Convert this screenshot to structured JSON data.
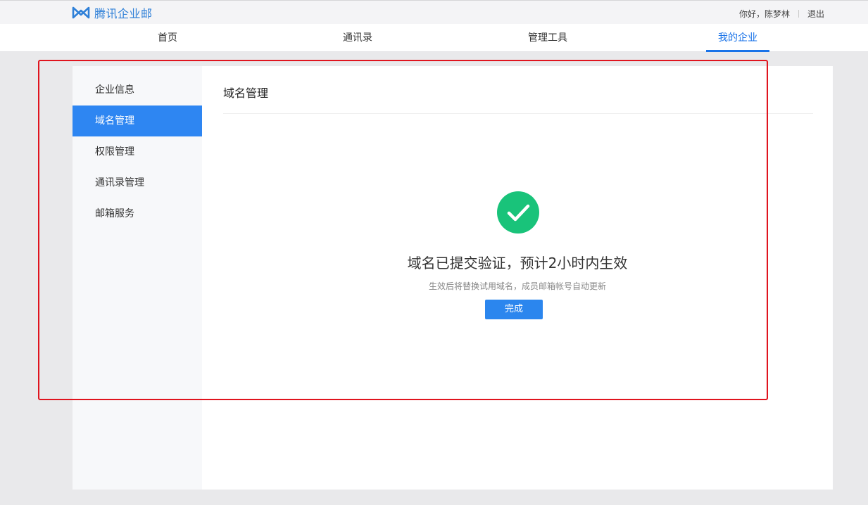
{
  "app": {
    "logo_text": "腾讯企业邮",
    "greeting": "你好，陈梦林",
    "logout": "退出",
    "brand_color": "#2f80d8"
  },
  "nav": {
    "items": [
      {
        "label": "首页"
      },
      {
        "label": "通讯录"
      },
      {
        "label": "管理工具"
      },
      {
        "label": "我的企业",
        "active": true
      }
    ],
    "accent": "#1a73e8"
  },
  "sidebar": {
    "items": [
      {
        "label": "企业信息"
      },
      {
        "label": "域名管理",
        "active": true
      },
      {
        "label": "权限管理"
      },
      {
        "label": "通讯录管理"
      },
      {
        "label": "邮箱服务"
      }
    ]
  },
  "content": {
    "title": "域名管理",
    "status_icon": "check-circle-icon",
    "status_color": "#19c37a",
    "headline": "域名已提交验证，预计2小时内生效",
    "subtext": "生效后将替换试用域名，成员邮箱帐号自动更新",
    "done_button": "完成"
  },
  "annotation": {
    "highlight_color": "#e0141e"
  }
}
